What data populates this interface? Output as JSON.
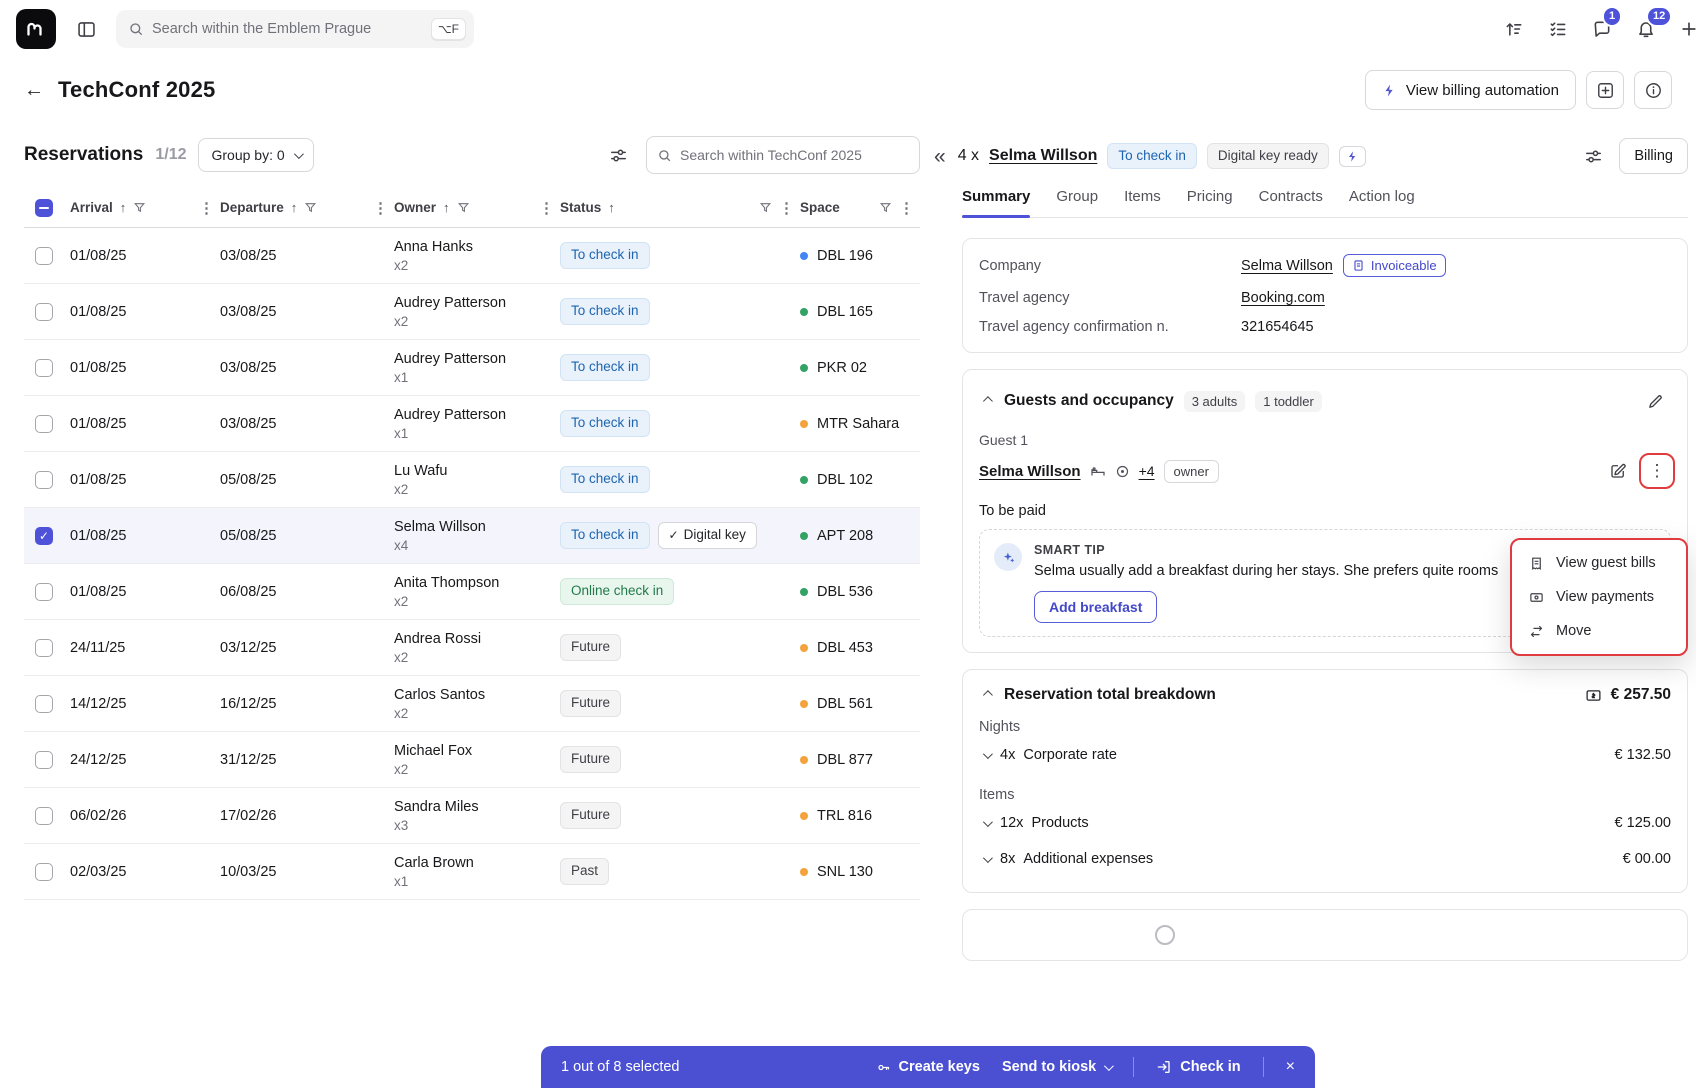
{
  "topbar": {
    "search_placeholder": "Search within the Emblem Prague",
    "search_shortcut": "⌥F",
    "messages_badge": "1",
    "notifications_badge": "12"
  },
  "page": {
    "title": "TechConf 2025",
    "billing_automation_label": "View billing automation"
  },
  "reservations": {
    "title": "Reservations",
    "count": "1/12",
    "group_by_label": "Group by: 0",
    "search_placeholder": "Search within TechConf 2025",
    "columns": {
      "arrival": "Arrival",
      "departure": "Departure",
      "owner": "Owner",
      "status": "Status",
      "space": "Space"
    },
    "rows": [
      {
        "arrival": "01/08/25",
        "departure": "03/08/25",
        "owner": "Anna Hanks",
        "occupancy": "x2",
        "status": "To check in",
        "status_type": "info",
        "digital_key": false,
        "digital_key_label": "",
        "space": "DBL 196",
        "dot": "blue",
        "selected": false
      },
      {
        "arrival": "01/08/25",
        "departure": "03/08/25",
        "owner": "Audrey Patterson",
        "occupancy": "x2",
        "status": "To check in",
        "status_type": "info",
        "digital_key": false,
        "digital_key_label": "",
        "space": "DBL 165",
        "dot": "green",
        "selected": false
      },
      {
        "arrival": "01/08/25",
        "departure": "03/08/25",
        "owner": "Audrey Patterson",
        "occupancy": "x1",
        "status": "To check in",
        "status_type": "info",
        "digital_key": false,
        "digital_key_label": "",
        "space": "PKR 02",
        "dot": "green",
        "selected": false
      },
      {
        "arrival": "01/08/25",
        "departure": "03/08/25",
        "owner": "Audrey Patterson",
        "occupancy": "x1",
        "status": "To check in",
        "status_type": "info",
        "digital_key": false,
        "digital_key_label": "",
        "space": "MTR Sahara",
        "dot": "orange",
        "selected": false
      },
      {
        "arrival": "01/08/25",
        "departure": "05/08/25",
        "owner": "Lu Wafu",
        "occupancy": "x2",
        "status": "To check in",
        "status_type": "info",
        "digital_key": false,
        "digital_key_label": "",
        "space": "DBL 102",
        "dot": "green",
        "selected": false
      },
      {
        "arrival": "01/08/25",
        "departure": "05/08/25",
        "owner": "Selma Willson",
        "occupancy": "x4",
        "status": "To check in",
        "status_type": "info",
        "digital_key": true,
        "digital_key_label": "Digital key",
        "space": "APT 208",
        "dot": "green",
        "selected": true
      },
      {
        "arrival": "01/08/25",
        "departure": "06/08/25",
        "owner": "Anita Thompson",
        "occupancy": "x2",
        "status": "Online check in",
        "status_type": "success",
        "digital_key": false,
        "digital_key_label": "",
        "space": "DBL 536",
        "dot": "green",
        "selected": false
      },
      {
        "arrival": "24/11/25",
        "departure": "03/12/25",
        "owner": "Andrea Rossi",
        "occupancy": "x2",
        "status": "Future",
        "status_type": "neutral",
        "digital_key": false,
        "digital_key_label": "",
        "space": "DBL 453",
        "dot": "orange",
        "selected": false
      },
      {
        "arrival": "14/12/25",
        "departure": "16/12/25",
        "owner": "Carlos Santos",
        "occupancy": "x2",
        "status": "Future",
        "status_type": "neutral",
        "digital_key": false,
        "digital_key_label": "",
        "space": "DBL 561",
        "dot": "orange",
        "selected": false
      },
      {
        "arrival": "24/12/25",
        "departure": "31/12/25",
        "owner": "Michael Fox",
        "occupancy": "x2",
        "status": "Future",
        "status_type": "neutral",
        "digital_key": false,
        "digital_key_label": "",
        "space": "DBL 877",
        "dot": "orange",
        "selected": false
      },
      {
        "arrival": "06/02/26",
        "departure": "17/02/26",
        "owner": "Sandra Miles",
        "occupancy": "x3",
        "status": "Future",
        "status_type": "neutral",
        "digital_key": false,
        "digital_key_label": "",
        "space": "TRL 816",
        "dot": "orange",
        "selected": false
      },
      {
        "arrival": "02/03/25",
        "departure": "10/03/25",
        "owner": "Carla Brown",
        "occupancy": "x1",
        "status": "Past",
        "status_type": "neutral",
        "digital_key": false,
        "digital_key_label": "",
        "space": "SNL 130",
        "dot": "orange",
        "selected": false
      }
    ]
  },
  "detail": {
    "count_prefix": "4 x",
    "guest_name": "Selma Willson",
    "status_badge": "To check in",
    "key_badge": "Digital key ready",
    "billing_label": "Billing",
    "tabs": [
      "Summary",
      "Group",
      "Items",
      "Pricing",
      "Contracts",
      "Action log"
    ],
    "active_tab": "Summary",
    "info": {
      "company_label": "Company",
      "company_value": "Selma Willson",
      "invoiceable_badge": "Invoiceable",
      "agency_label": "Travel agency",
      "agency_value": "Booking.com",
      "confirmation_label": "Travel agency confirmation n.",
      "confirmation_value": "321654645"
    },
    "guests": {
      "title": "Guests and occupancy",
      "adults_badge": "3 adults",
      "toddler_badge": "1 toddler",
      "guest_label": "Guest 1",
      "guest_name": "Selma Willson",
      "extra_count": "+4",
      "owner_badge": "owner",
      "to_be_paid": "To be paid",
      "smart_tip": {
        "title": "SMART TIP",
        "text": "Selma usually add a breakfast during her stays. She prefers quite rooms",
        "button": "Add breakfast"
      }
    },
    "menu": {
      "items": [
        {
          "label": "View guest bills"
        },
        {
          "label": "View payments"
        },
        {
          "label": "Move"
        }
      ]
    },
    "breakdown": {
      "title": "Reservation total breakdown",
      "total": "€ 257.50",
      "groups": [
        {
          "label": "Nights",
          "rows": [
            {
              "qty": "4x",
              "name": "Corporate rate",
              "amount": "€ 132.50"
            }
          ]
        },
        {
          "label": "Items",
          "rows": [
            {
              "qty": "12x",
              "name": "Products",
              "amount": "€ 125.00"
            },
            {
              "qty": "8x",
              "name": "Additional expenses",
              "amount": "€ 00.00"
            }
          ]
        }
      ]
    }
  },
  "footer": {
    "selected_text": "1 out of 8 selected",
    "create_keys": "Create keys",
    "send_to_kiosk": "Send to kiosk",
    "check_in": "Check in"
  }
}
